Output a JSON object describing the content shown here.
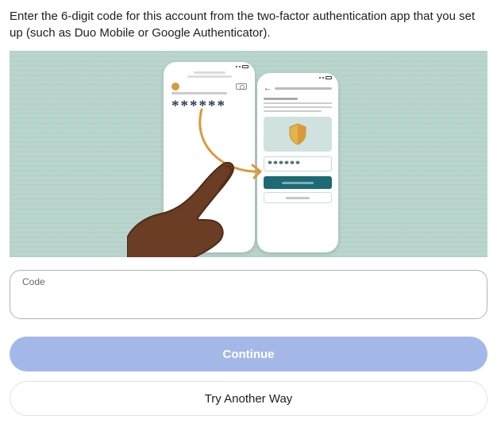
{
  "instruction": "Enter the 6-digit code for this account from the two-factor authentication app that you set up (such as Duo Mobile or Google Authenticator).",
  "illustration": {
    "left_phone_code_mask": "******",
    "right_phone_code_mask": "******"
  },
  "code_field": {
    "label": "Code",
    "value": "",
    "placeholder": ""
  },
  "buttons": {
    "continue": "Continue",
    "try_another_way": "Try Another Way"
  }
}
